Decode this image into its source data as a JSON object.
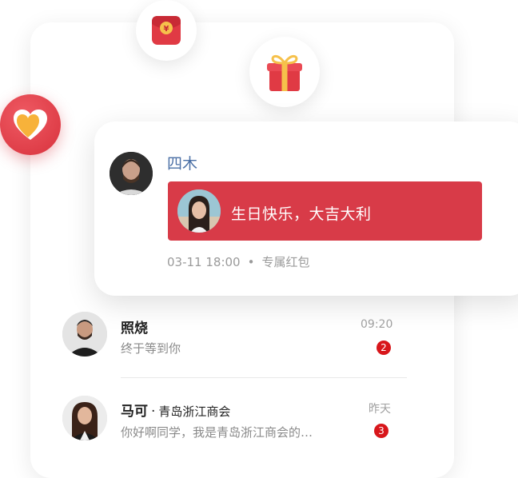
{
  "icons": {
    "envelope": "red-envelope-icon",
    "gift": "gift-box-icon",
    "heart": "heart-icon"
  },
  "colors": {
    "accent_red": "#d83b48",
    "sender_blue": "#4a6fa5",
    "badge_red": "#d8161b"
  },
  "message": {
    "sender": "四木",
    "packet_text": "生日快乐，大吉大利",
    "time": "03-11 18:00",
    "separator": "•",
    "tag": "专属红包"
  },
  "chats": [
    {
      "name": "照烧",
      "preview": "终于等到你",
      "time": "09:20",
      "unread": "2"
    },
    {
      "name": "马可",
      "separator": "·",
      "group": "青岛浙江商会",
      "preview": "你好啊同学，我是青岛浙江商会的…",
      "time": "昨天",
      "unread": "3"
    }
  ]
}
